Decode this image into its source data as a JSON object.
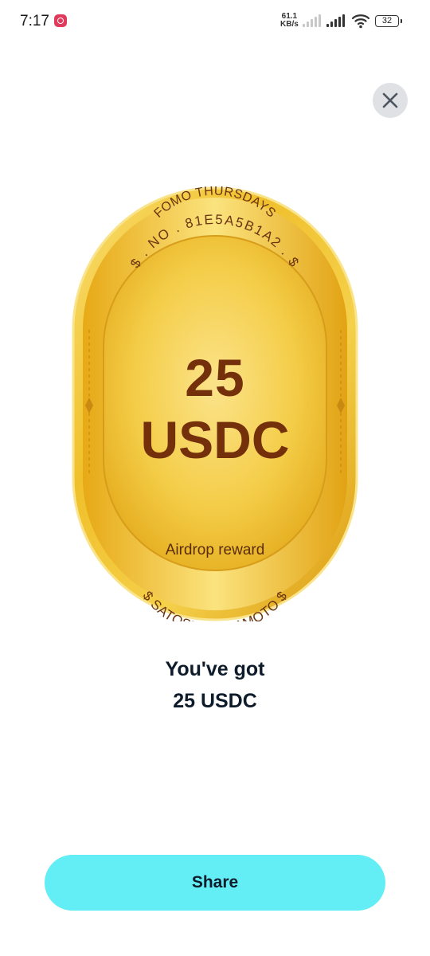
{
  "status_bar": {
    "time": "7:17",
    "speed_value": "61.1",
    "speed_unit": "KB/s",
    "battery": "32"
  },
  "coin": {
    "event": "FOMO THURSDAYS",
    "serial": "$ . NO . 81E5A5B1A2 . $",
    "amount": "25",
    "currency": "USDC",
    "caption": "Airdrop reward",
    "signature": "$ SATOSHI NAKAMOTO $",
    "colors": {
      "gold_light": "#f7d65a",
      "gold_dark": "#d99a0e",
      "text_brown": "#74300b"
    }
  },
  "reward": {
    "line1": "You've got",
    "line2": "25 USDC"
  },
  "actions": {
    "share_label": "Share",
    "share_color": "#63eef5"
  },
  "icons": {
    "close": "close-icon",
    "instagram": "instagram-icon",
    "wifi": "wifi-icon",
    "battery": "battery-icon"
  }
}
